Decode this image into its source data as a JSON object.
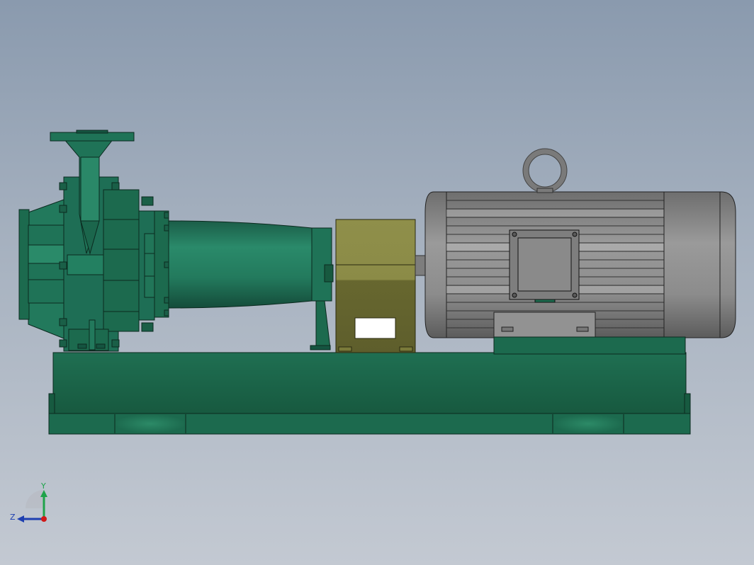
{
  "viewport": {
    "background_top": "#8a9aae",
    "background_bottom": "#c3c9d2"
  },
  "model": {
    "pump_color": "#1e6e55",
    "coupling_guard_color": "#6e6e36",
    "motor_color": "#8c8c8c",
    "baseplate_color": "#1c6a4e"
  },
  "triad": {
    "y_label": "Y",
    "z_label": "Z",
    "y_color": "#1fa34a",
    "z_color": "#1e3fb0",
    "x_color": "#d01818"
  }
}
